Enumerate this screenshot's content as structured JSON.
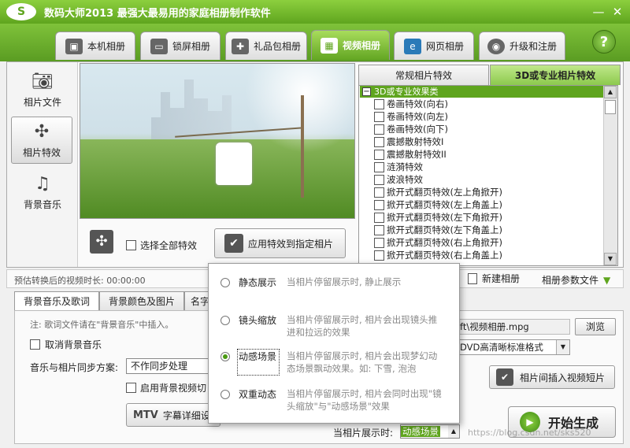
{
  "window": {
    "logo": "S",
    "title": "数码大师2013    最强大最易用的家庭相册制作软件",
    "min_glyph": "—",
    "close_glyph": "✕"
  },
  "tabs": [
    {
      "label": "本机相册",
      "icon": "computer-photo-icon",
      "active": false
    },
    {
      "label": "锁屏相册",
      "icon": "monitor-lock-icon",
      "active": false
    },
    {
      "label": "礼品包相册",
      "icon": "gift-box-icon",
      "active": false
    },
    {
      "label": "视频相册",
      "icon": "film-strip-icon",
      "active": true
    },
    {
      "label": "网页相册",
      "icon": "ie-browser-icon",
      "active": false
    },
    {
      "label": "升级和注册",
      "icon": "globe-upgrade-icon",
      "active": false
    }
  ],
  "help_glyph": "?",
  "leftnav": [
    {
      "label": "相片文件",
      "icon": "camera-icon",
      "selected": false
    },
    {
      "label": "相片特效",
      "icon": "effects-icon",
      "selected": true
    },
    {
      "label": "背景音乐",
      "icon": "music-note-icon",
      "selected": false
    }
  ],
  "preview": {
    "select_all_label": "选择全部特效",
    "apply_label": "应用特效到指定相片"
  },
  "effects": {
    "tabs": [
      "常规相片特效",
      "3D或专业相片特效"
    ],
    "active_tab": 1,
    "category": "3D或专业效果类",
    "items": [
      "卷画特效(向右)",
      "卷画特效(向左)",
      "卷画特效(向下)",
      "震撼散射特效I",
      "震撼散射特效II",
      "涟漪特效",
      "波浪特效",
      "掀开式翻页特效(左上角掀开)",
      "掀开式翻页特效(左上角盖上)",
      "掀开式翻页特效(左下角掀开)",
      "掀开式翻页特效(左下角盖上)",
      "掀开式翻页特效(右上角掀开)",
      "掀开式翻页特效(右上角盖上)"
    ]
  },
  "status": {
    "duration_label": "预估转换后的视频时长: 00:00:00",
    "new_album": "新建相册",
    "album_params": "相册参数文件"
  },
  "bottom_tabs": [
    "背景音乐及歌词",
    "背景颜色及图片",
    "名字"
  ],
  "bottom": {
    "note": "注: 歌词文件请在\"背景音乐\"中插入。",
    "cancel_bg_music": "取消背景音乐",
    "sync_label": "音乐与相片同步方案:",
    "sync_value": "不作同步处理",
    "bg_video": "启用背景视频切",
    "mtv_prefix": "MTV",
    "mtv_label": "字幕详细设",
    "file_path": "ft\\视频相册.mpg",
    "browse": "浏览",
    "format": "DVD高清晰标准格式",
    "insert_video": "相片间插入视频短片",
    "start": "开始生成",
    "display_label": "当相片展示时:",
    "display_value": "动感场景"
  },
  "popup": {
    "options": [
      {
        "name": "静态展示",
        "desc": "当相片停留展示时, 静止展示",
        "selected": false
      },
      {
        "name": "镜头缩放",
        "desc": "当相片停留展示时, 相片会出现镜头推进和拉远的效果",
        "selected": false
      },
      {
        "name": "动感场景",
        "desc": "当相片停留展示时, 相片会出现梦幻动态场景飘动效果。如: 下雪, 泡泡",
        "selected": true
      },
      {
        "name": "双重动态",
        "desc": "当相片停留展示时, 相片会同时出现\"镜头缩放\"与\"动感场景\"效果",
        "selected": false
      }
    ]
  },
  "watermark": "https://blog.csdn.net/sks520",
  "colors": {
    "accent": "#5fa51e",
    "titlebar": "#7fc23a"
  }
}
